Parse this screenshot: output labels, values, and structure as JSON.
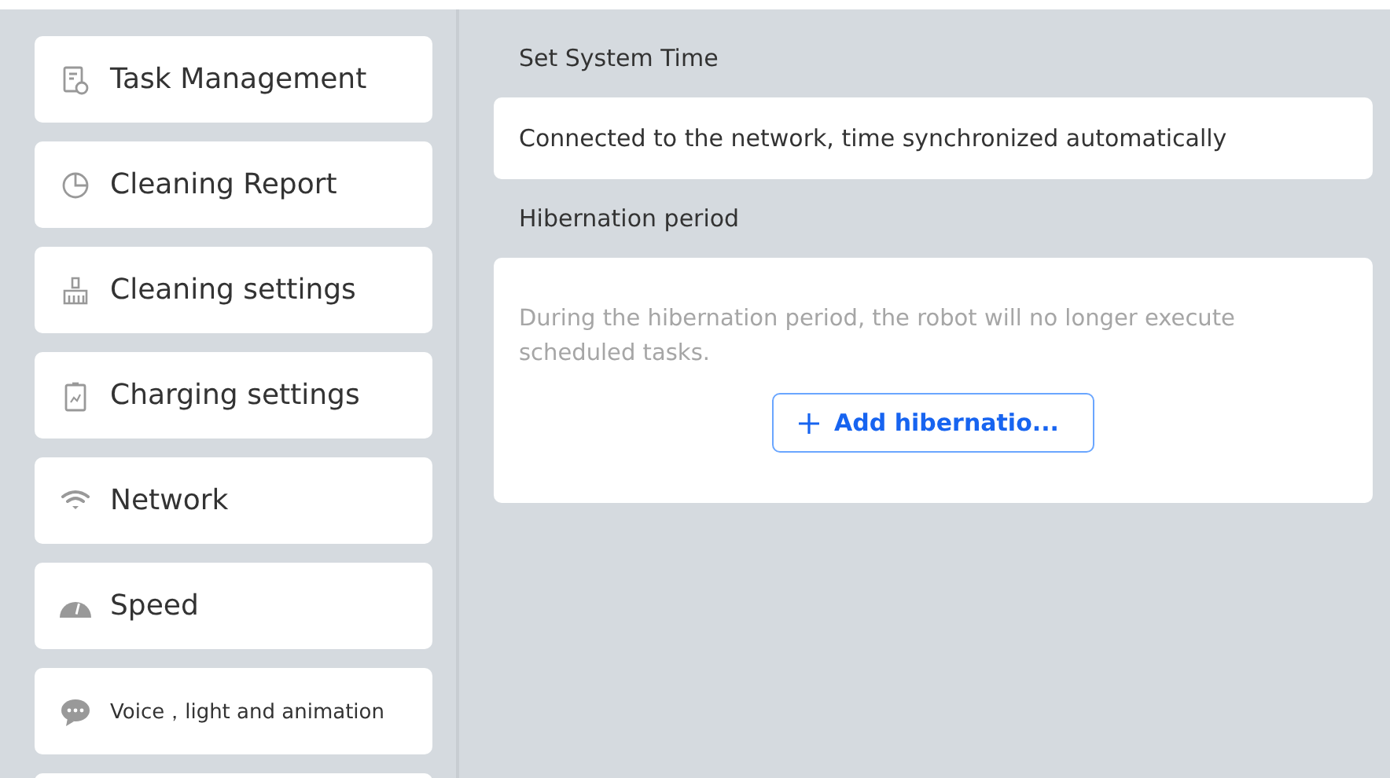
{
  "sidebar": {
    "items": [
      {
        "label": "Task Management"
      },
      {
        "label": "Cleaning Report"
      },
      {
        "label": "Cleaning settings"
      },
      {
        "label": "Charging settings"
      },
      {
        "label": "Network"
      },
      {
        "label": "Speed"
      },
      {
        "label": "Voice，light and animation"
      }
    ]
  },
  "sections": [
    {
      "title": "Set System Time",
      "text": "Connected to the network, time synchronized automatically",
      "kind": "info"
    },
    {
      "title": "Hibernation period",
      "text": "During the hibernation period, the robot will no longer execute scheduled tasks.",
      "kind": "action",
      "button": "Add hibernatio..."
    }
  ]
}
